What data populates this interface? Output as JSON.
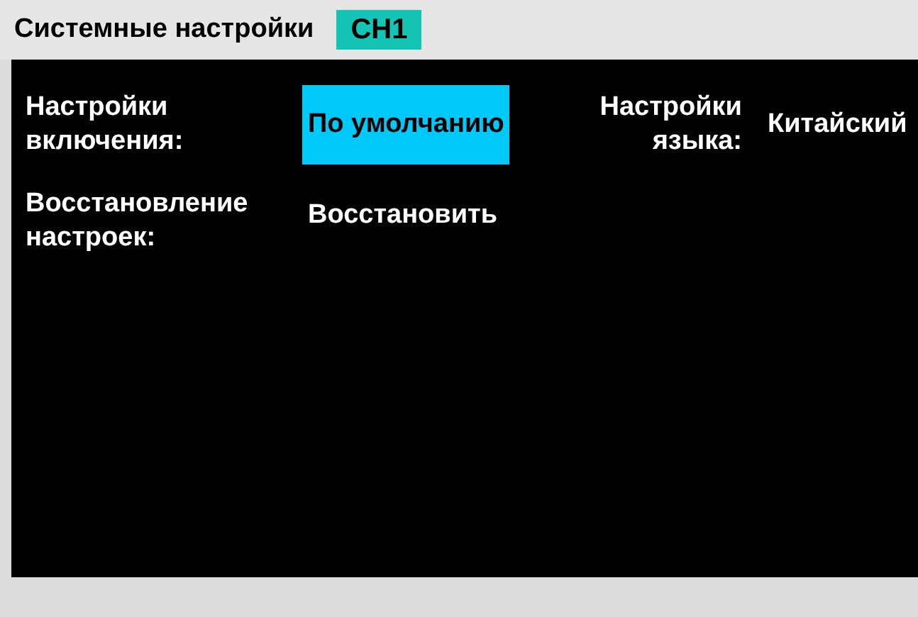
{
  "header": {
    "title": "Системные настройки",
    "channel": "CH1"
  },
  "settings": [
    {
      "label": "Настройки включения:",
      "value": "По умолчанию",
      "selected": true
    },
    {
      "label": "Настройки языка:",
      "value": "Китайский",
      "selected": false
    },
    {
      "label": "Восстановление настроек:",
      "value": "Восстановить",
      "selected": false
    }
  ]
}
